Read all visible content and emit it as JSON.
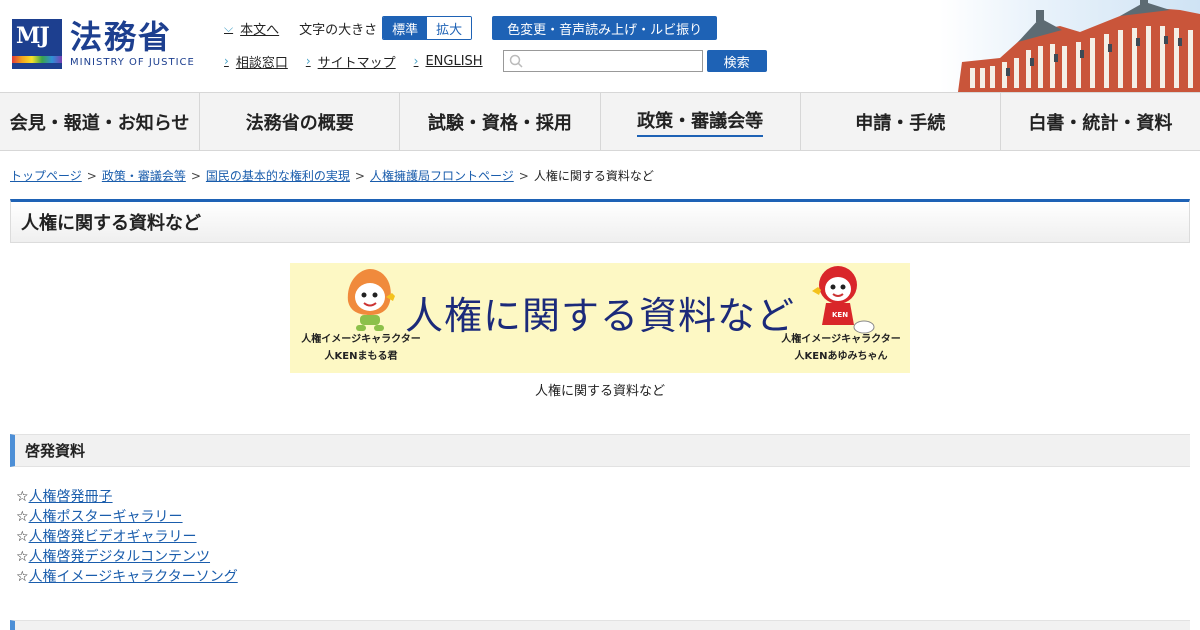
{
  "header": {
    "logo_title": "法務省",
    "logo_sub": "MINISTRY OF JUSTICE",
    "util": {
      "skip_link": "本文へ",
      "font_size_label": "文字の大きさ",
      "font_standard": "標準",
      "font_large": "拡大",
      "accessibility_button": "色変更・音声読み上げ・ルビ振り",
      "consult_link": "相談窓口",
      "sitemap_link": "サイトマップ",
      "english_link": "ENGLISH",
      "search_placeholder": "",
      "search_button": "検索"
    }
  },
  "gnav": {
    "items": [
      "会見・報道・お知らせ",
      "法務省の概要",
      "試験・資格・採用",
      "政策・審議会等",
      "申請・手続",
      "白書・統計・資料"
    ],
    "active_index": 3
  },
  "breadcrumb": {
    "items": [
      "トップページ",
      "政策・審議会等",
      "国民の基本的な権利の実現",
      "人権擁護局フロントページ"
    ],
    "current": "人権に関する資料など",
    "separator": ">"
  },
  "page": {
    "title": "人権に関する資料など",
    "banner": {
      "title": "人権に関する資料など",
      "left_caption_1": "人権イメージキャラクター",
      "left_caption_2": "人KENまもる君",
      "right_caption_1": "人権イメージキャラクター",
      "right_caption_2": "人KENあゆみちゃん",
      "badge_text": "KEN"
    },
    "banner_caption": "人権に関する資料など",
    "section_title": "啓発資料",
    "links": [
      "人権啓発冊子",
      "人権ポスターギャラリー",
      "人権啓発ビデオギャラリー",
      "人権啓発デジタルコンテンツ",
      "人権イメージキャラクターソング"
    ],
    "link_prefix": "☆"
  },
  "colors": {
    "brand_blue": "#1e62b5",
    "logo_navy": "#1d3f8f",
    "banner_bg": "#fdf8c4",
    "section_accent": "#4d8fd6"
  }
}
